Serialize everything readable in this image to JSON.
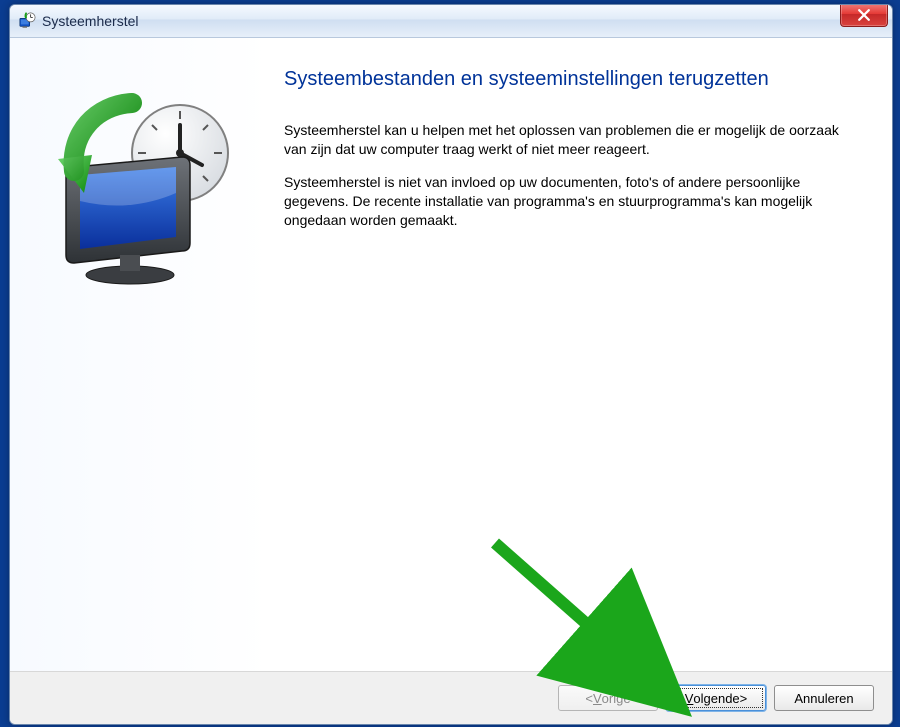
{
  "window": {
    "title": "Systeemherstel"
  },
  "main": {
    "heading": "Systeembestanden en systeeminstellingen terugzetten",
    "para1": "Systeemherstel kan u helpen met het oplossen van problemen die er mogelijk de oorzaak van zijn dat uw computer traag werkt of niet meer reageert.",
    "para2": "Systeemherstel is niet van invloed op uw documenten, foto's of andere persoonlijke gegevens. De recente installatie van programma's en stuurprogramma's kan mogelijk ongedaan worden gemaakt."
  },
  "footer": {
    "back_prefix": "< ",
    "back_u": "V",
    "back_rest": "orige",
    "next_u": "V",
    "next_rest": "olgende",
    "next_suffix": " >",
    "cancel": "Annuleren"
  }
}
